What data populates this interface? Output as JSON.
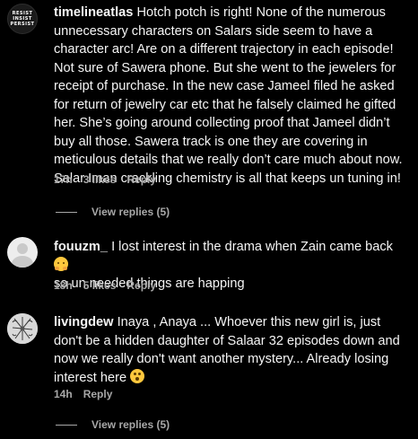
{
  "comments": [
    {
      "username": "timelineatlas",
      "avatar_lines": [
        "RESIST",
        "INSIST",
        "PERSIST"
      ],
      "text": "Hotch potch is right! None of the numerous unnecessary characters on Salars side seem to have a character arc! Are on a different trajectory in each episode! Not sure of Sawera phone. But she went to the jewelers for receipt of purchase. In the new case Jameel filed he asked for return of jewelry car etc that he falsely claimed he gifted her. She’s going around collecting proof that Jameel didn’t buy all those. Sawera track is one they are covering in meticulous details that we really don’t care much about now. Salar Iman crackling chemistry is all that keeps un tuning in!",
      "time": "17h",
      "likes": "3 likes",
      "reply": "Reply",
      "view_replies": "View replies (5)"
    },
    {
      "username": "fouuzm_",
      "text": "I lost interest in the drama when Zain came back",
      "text2": "so un needed things are happing",
      "emoji": "hugging-face-emoji",
      "time": "18h",
      "likes": "5 likes",
      "reply": "Reply"
    },
    {
      "username": "livingdew",
      "text": "Inaya , Anaya ... Whoever this new girl is, just don't be a hidden daughter of Salaar 32 episodes down and now we really don't want another mystery... Already losing interest here",
      "emoji": "astonished-face-emoji",
      "time": "14h",
      "reply": "Reply",
      "view_replies": "View replies (5)"
    }
  ],
  "colors": {
    "background": "#000000",
    "text": "#f5f5f5",
    "secondary": "#a8a8a8"
  }
}
